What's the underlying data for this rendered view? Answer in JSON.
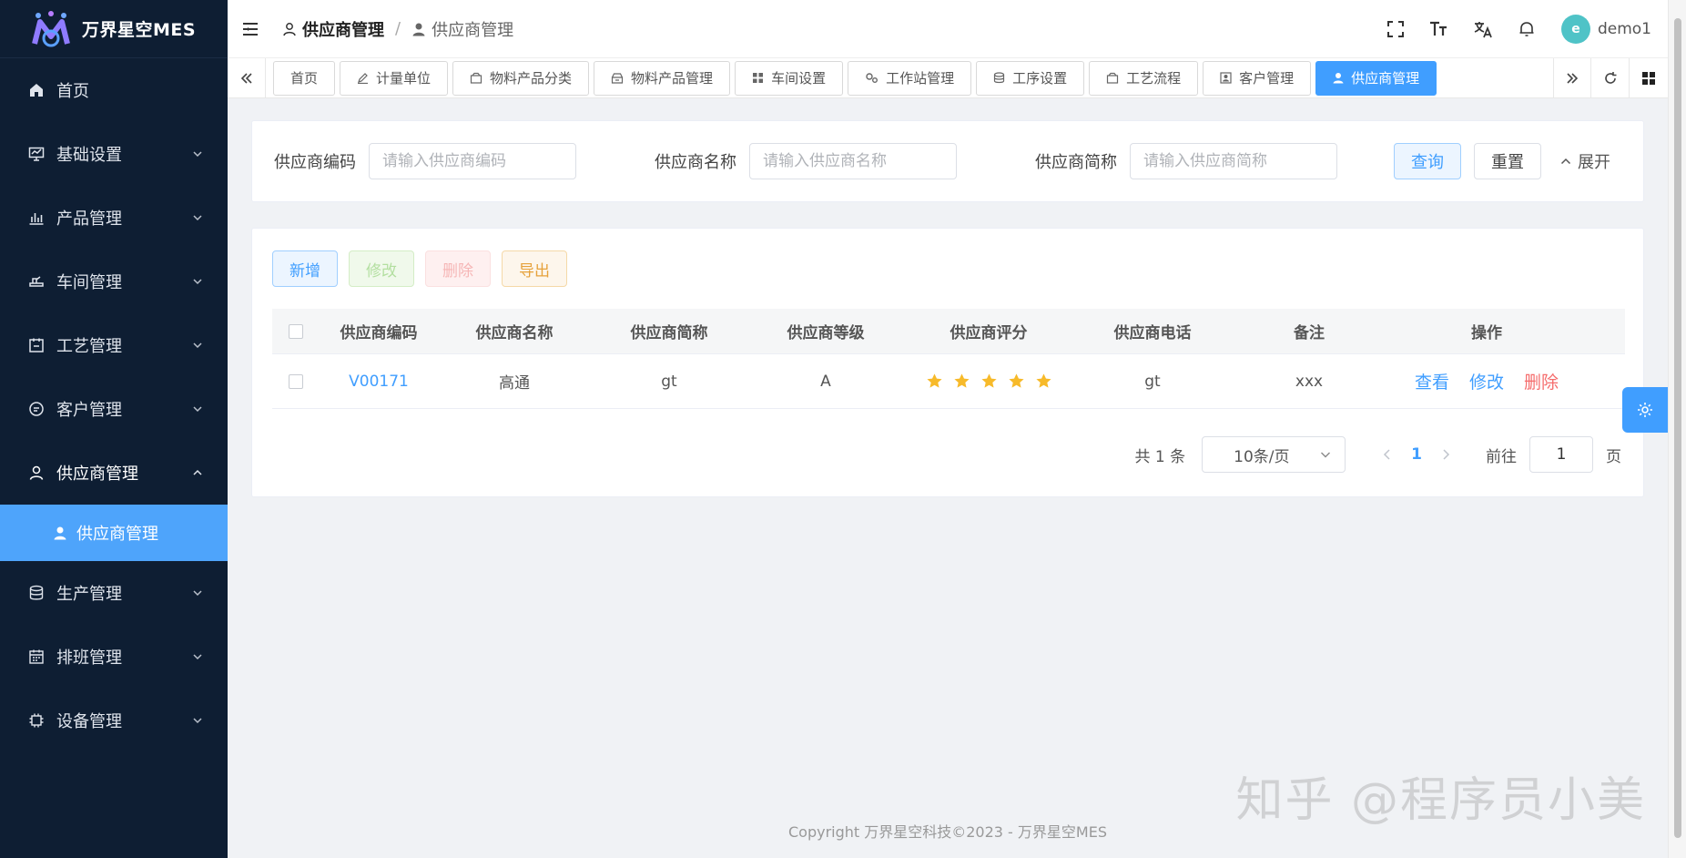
{
  "app": {
    "logo_text": "万界星空MES"
  },
  "sidebar": {
    "items": [
      {
        "label": "首页",
        "icon": "home-icon"
      },
      {
        "label": "基础设置",
        "icon": "monitor-icon"
      },
      {
        "label": "产品管理",
        "icon": "chart-icon"
      },
      {
        "label": "车间管理",
        "icon": "workshop-icon"
      },
      {
        "label": "工艺管理",
        "icon": "process-icon"
      },
      {
        "label": "客户管理",
        "icon": "chat-icon"
      },
      {
        "label": "供应商管理",
        "icon": "user-icon"
      },
      {
        "label": "生产管理",
        "icon": "database-icon"
      },
      {
        "label": "排班管理",
        "icon": "calendar-icon"
      },
      {
        "label": "设备管理",
        "icon": "chip-icon"
      }
    ],
    "sub_active": "供应商管理"
  },
  "header": {
    "breadcrumb": [
      "供应商管理",
      "供应商管理"
    ],
    "user": "demo1"
  },
  "tabs": [
    {
      "label": "首页",
      "icon": ""
    },
    {
      "label": "计量单位",
      "icon": "edit-icon"
    },
    {
      "label": "物料产品分类",
      "icon": "box-icon"
    },
    {
      "label": "物料产品管理",
      "icon": "box-open-icon"
    },
    {
      "label": "车间设置",
      "icon": "grid-icon"
    },
    {
      "label": "工作站管理",
      "icon": "gears-icon"
    },
    {
      "label": "工序设置",
      "icon": "layers-icon"
    },
    {
      "label": "工艺流程",
      "icon": "box-icon"
    },
    {
      "label": "客户管理",
      "icon": "contact-icon"
    },
    {
      "label": "供应商管理",
      "icon": "user-icon"
    }
  ],
  "search": {
    "code_label": "供应商编码",
    "code_placeholder": "请输入供应商编码",
    "name_label": "供应商名称",
    "name_placeholder": "请输入供应商名称",
    "short_label": "供应商简称",
    "short_placeholder": "请输入供应商简称",
    "query": "查询",
    "reset": "重置",
    "expand": "展开"
  },
  "actions": {
    "add": "新增",
    "edit": "修改",
    "delete": "删除",
    "export": "导出"
  },
  "table": {
    "headers": [
      "供应商编码",
      "供应商名称",
      "供应商简称",
      "供应商等级",
      "供应商评分",
      "供应商电话",
      "备注",
      "操作"
    ],
    "rows": [
      {
        "code": "V00171",
        "name": "高通",
        "short": "gt",
        "level": "A",
        "rating": 5,
        "phone": "gt",
        "remark": "xxx"
      }
    ],
    "ops": {
      "view": "查看",
      "edit": "修改",
      "delete": "删除"
    },
    "star_color": "#f7ba2a"
  },
  "pager": {
    "total": "共 1 条",
    "size": "10条/页",
    "current": "1",
    "goto": "前往",
    "input": "1",
    "unit": "页"
  },
  "footer": "Copyright 万界星空科技©2023 - 万界星空MES",
  "watermark": "知乎 @程序员小美",
  "colors": {
    "sidebar_bg": "#0e1e33",
    "accent": "#409eff",
    "danger": "#f56c6c"
  }
}
